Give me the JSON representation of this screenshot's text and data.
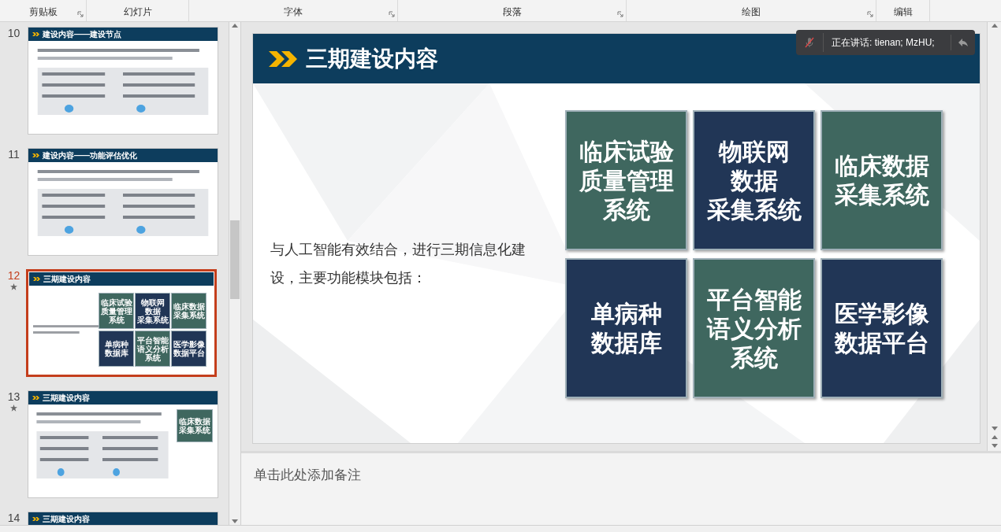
{
  "ribbon_groups": [
    {
      "label": "剪贴板",
      "launcher": true
    },
    {
      "label": "幻灯片",
      "launcher": false
    },
    {
      "label": "字体",
      "launcher": true
    },
    {
      "label": "段落",
      "launcher": true
    },
    {
      "label": "绘图",
      "launcher": true
    },
    {
      "label": "编辑",
      "launcher": false
    }
  ],
  "thumbnails": [
    {
      "number": "10",
      "title": "建设内容——建设节点",
      "selected": false,
      "animated": false,
      "kind": "sketch"
    },
    {
      "number": "11",
      "title": "建设内容——功能评估优化",
      "selected": false,
      "animated": false,
      "kind": "sketch"
    },
    {
      "number": "12",
      "title": "三期建设内容",
      "selected": true,
      "animated": true,
      "kind": "full",
      "tiles": [
        {
          "lines": [
            "临床试验",
            "质量管理",
            "系统"
          ],
          "color": "#3f675f"
        },
        {
          "lines": [
            "物联网",
            "数据",
            "采集系统"
          ],
          "color": "#213656"
        },
        {
          "lines": [
            "临床数据",
            "采集系统"
          ],
          "color": "#3f675f"
        },
        {
          "lines": [
            "单病种",
            "数据库"
          ],
          "color": "#213656"
        },
        {
          "lines": [
            "平台智能",
            "语义分析",
            "系统"
          ],
          "color": "#3f675f"
        },
        {
          "lines": [
            "医学影像",
            "数据平台"
          ],
          "color": "#213656"
        }
      ]
    },
    {
      "number": "13",
      "title": "三期建设内容",
      "selected": false,
      "animated": true,
      "kind": "sketch",
      "tiles": [
        {
          "lines": [
            "临床数据",
            "采集系统"
          ],
          "color": "#3f675f"
        }
      ]
    },
    {
      "number": "14",
      "title": "三期建设内容",
      "selected": false,
      "kind": "title_only"
    }
  ],
  "slide": {
    "title": "三期建设内容",
    "body": "与人工智能有效结合，进行三期信息化建设，主要功能模块包括：",
    "tiles": [
      {
        "lines": [
          "临床试验",
          "质量管理",
          "系统"
        ],
        "color": "#3f675f"
      },
      {
        "lines": [
          "物联网",
          "数据",
          "采集系统"
        ],
        "color": "#213656"
      },
      {
        "lines": [
          "临床数据",
          "采集系统"
        ],
        "color": "#3f675f"
      },
      {
        "lines": [
          "单病种",
          "数据库"
        ],
        "color": "#213656"
      },
      {
        "lines": [
          "平台智能",
          "语义分析",
          "系统"
        ],
        "color": "#3f675f"
      },
      {
        "lines": [
          "医学影像",
          "数据平台"
        ],
        "color": "#213656"
      }
    ]
  },
  "meeting_overlay": {
    "text": "正在讲话: tienan; MzHU;",
    "muted": true
  },
  "notes": {
    "placeholder": "单击此处添加备注"
  }
}
